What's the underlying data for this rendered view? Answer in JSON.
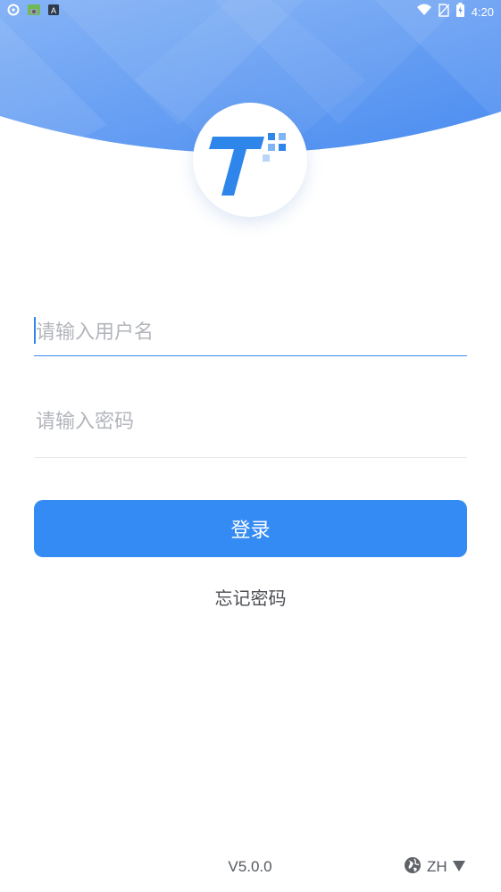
{
  "status_bar": {
    "time": "4:20",
    "icons": [
      "chat-bubble-icon",
      "sim-card-icon",
      "text-input-icon",
      "wifi-icon",
      "no-sim-icon",
      "battery-icon"
    ]
  },
  "logo": {
    "icon": "t-logo-icon"
  },
  "username": {
    "placeholder": "请输入用户名",
    "value": ""
  },
  "password": {
    "placeholder": "请输入密码",
    "value": ""
  },
  "login_button": {
    "label": "登录"
  },
  "forgot_password": {
    "label": "忘记密码"
  },
  "footer": {
    "version": "V5.0.0",
    "language": "ZH",
    "language_icon": "globe-icon",
    "dropdown_icon": "triangle-down-icon"
  },
  "colors": {
    "header_gradient_start": "#8bb6f6",
    "header_gradient_end": "#4d8ef0",
    "primary": "#358bf4",
    "logo_blue": "#2e86ea"
  }
}
